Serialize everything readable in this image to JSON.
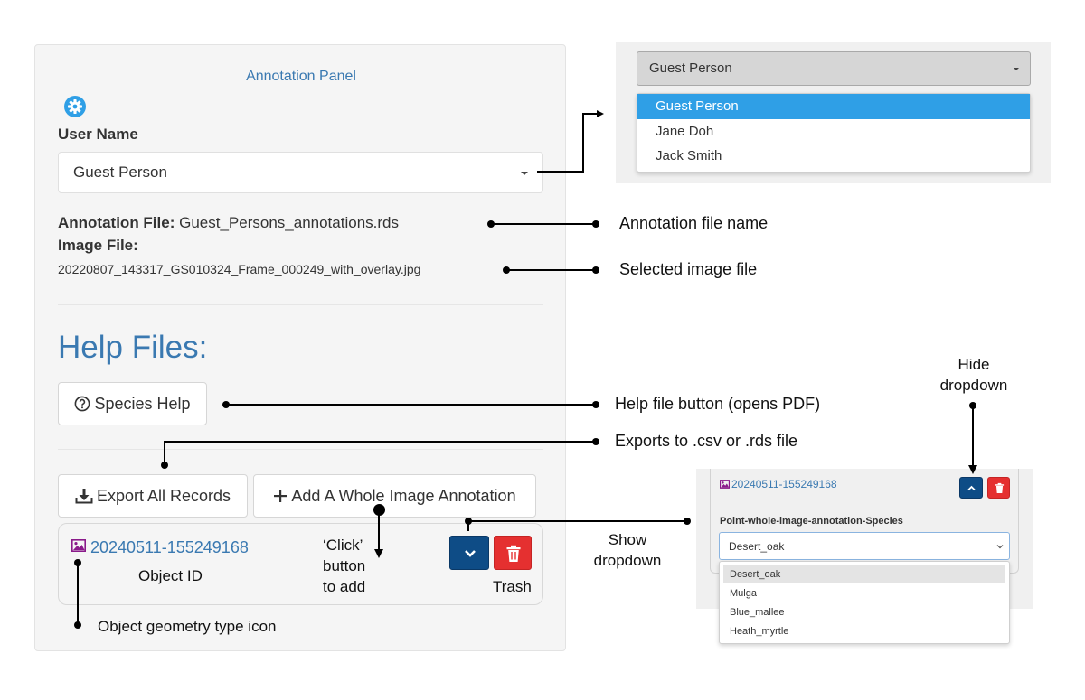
{
  "panel": {
    "title": "Annotation Panel",
    "user_label": "User Name",
    "user_select_value": "Guest Person",
    "annotation_file_label": "Annotation File:",
    "annotation_file_value": "Guest_Persons_annotations.rds",
    "image_file_label": "Image File:",
    "image_file_value": "20220807_143317_GS010324_Frame_000249_with_overlay.jpg",
    "help_heading": "Help Files:",
    "species_help_label": "Species Help",
    "export_label": "Export All Records",
    "add_label": "Add A Whole Image Annotation",
    "object_id": "20240511-155249168"
  },
  "user_dropdown": {
    "selected": "Guest Person",
    "options": [
      "Guest Person",
      "Jane Doh",
      "Jack Smith"
    ]
  },
  "species_card": {
    "object_id": "20240511-155249168",
    "field_label": "Point-whole-image-annotation-Species",
    "select_value": "Desert_oak",
    "options": [
      "Desert_oak",
      "Mulga",
      "Blue_mallee",
      "Heath_myrtle"
    ]
  },
  "annotations": {
    "annotation_file_name": "Annotation file name",
    "selected_image_file": "Selected image file",
    "help_file_button": "Help file button (opens PDF)",
    "exports": "Exports to .csv or .rds file",
    "hide_dropdown_line1": "Hide",
    "hide_dropdown_line2": "dropdown",
    "show_dropdown_line1": "Show",
    "show_dropdown_line2": "dropdown",
    "click_line1": "‘Click’",
    "click_line2": "button",
    "click_line3": "to add",
    "object_id": "Object ID",
    "trash": "Trash",
    "geometry_icon": "Object geometry type icon"
  },
  "colors": {
    "link_blue": "#3a79b1",
    "dark_blue_button": "#0e4c86",
    "red_button": "#e53030",
    "highlight_blue": "#2f9fe6",
    "image_icon_purple": "#8a1a8a"
  }
}
